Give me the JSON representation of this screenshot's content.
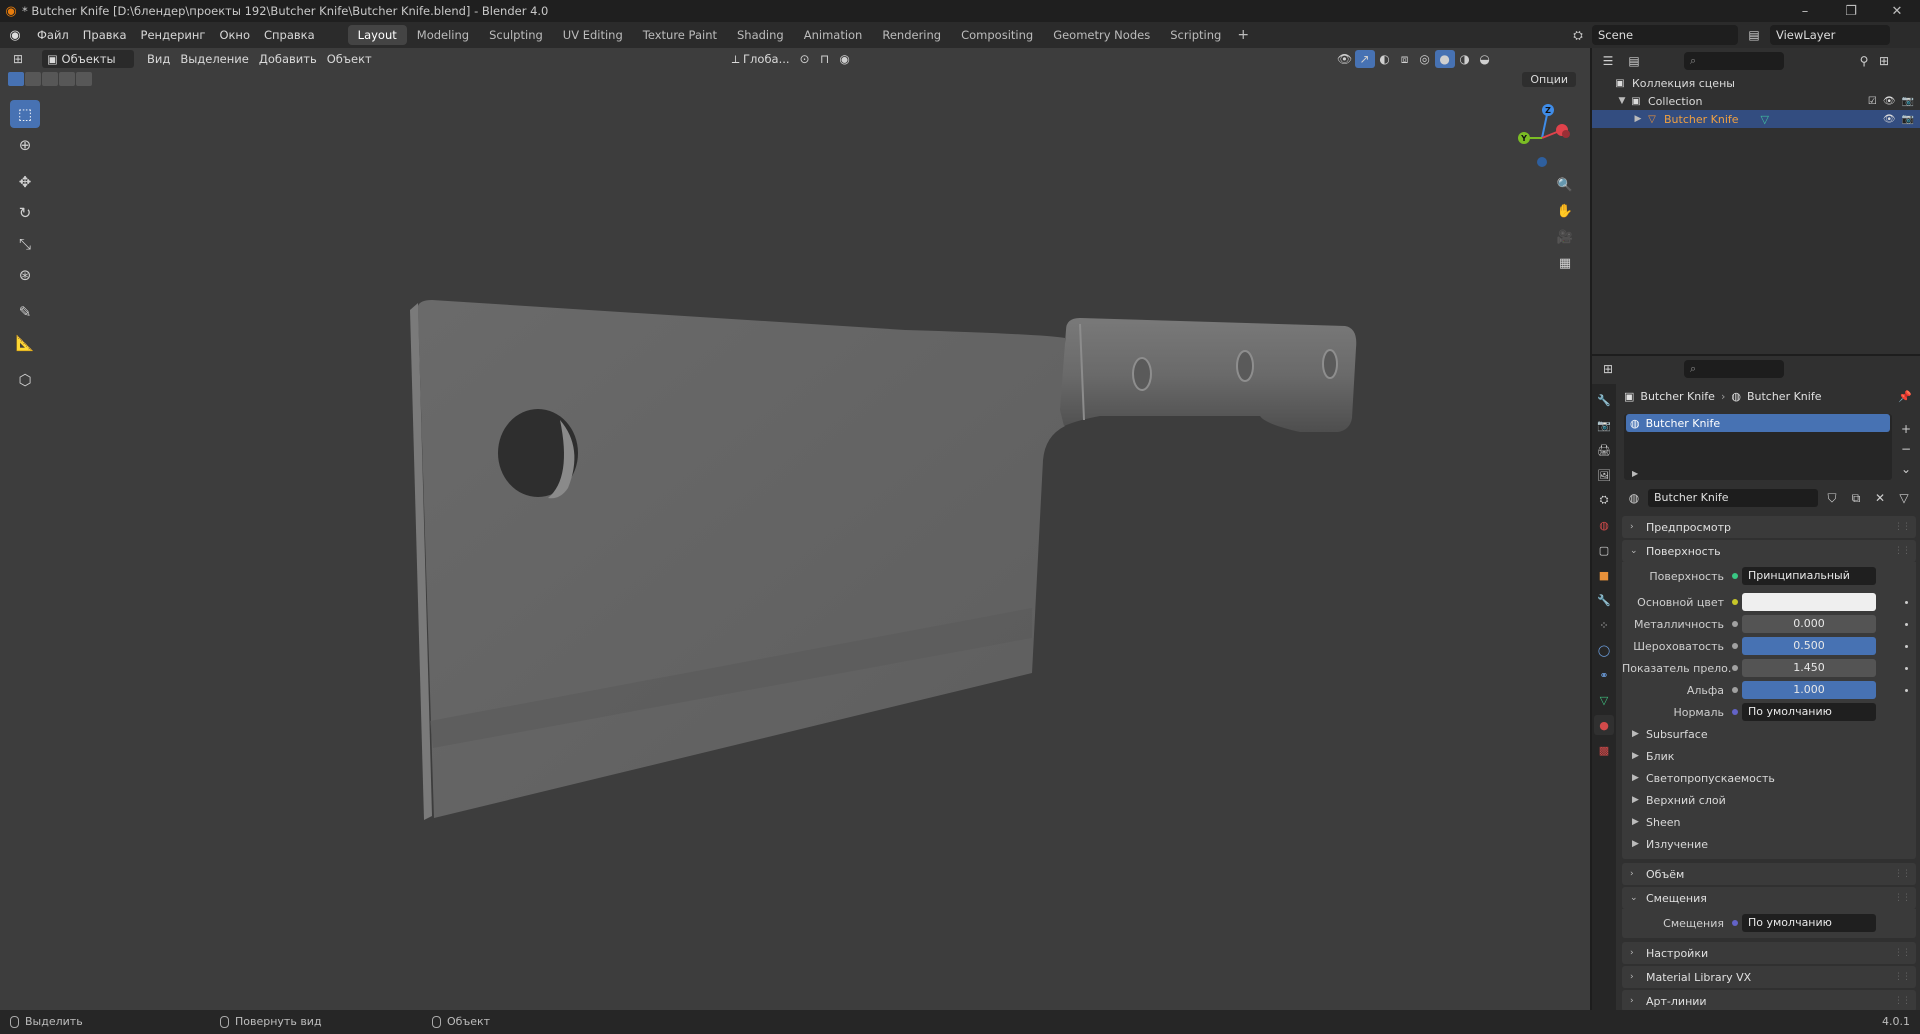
{
  "window": {
    "title": "* Butcher Knife [D:\\блендер\\проекты 192\\Butcher Knife\\Butcher Knife.blend] - Blender 4.0"
  },
  "menu": [
    "Файл",
    "Правка",
    "Рендеринг",
    "Окно",
    "Справка"
  ],
  "workspaces": [
    "Layout",
    "Modeling",
    "Sculpting",
    "UV Editing",
    "Texture Paint",
    "Shading",
    "Animation",
    "Rendering",
    "Compositing",
    "Geometry Nodes",
    "Scripting"
  ],
  "active_workspace": "Layout",
  "scene": {
    "name": "Scene",
    "view_layer": "ViewLayer"
  },
  "viewport": {
    "mode": "Объекты",
    "menus": [
      "Вид",
      "Выделение",
      "Добавить",
      "Объект"
    ],
    "orientation": "Глоба...",
    "options": "Опции"
  },
  "outliner": {
    "root": "Коллекция сцены",
    "collection": "Collection",
    "object": "Butcher Knife"
  },
  "properties": {
    "breadcrumb_object": "Butcher Knife",
    "breadcrumb_material": "Butcher Knife",
    "slot_name": "Butcher Knife",
    "material_name": "Butcher Knife",
    "sections": {
      "preview": "Предпросмотр",
      "surface": "Поверхность",
      "volume": "Объём",
      "displacement": "Смещения",
      "settings": "Настройки",
      "library": "Material Library VX",
      "lineart": "Арт-линии"
    },
    "surface": {
      "surface_label": "Поверхность",
      "surface_value": "Принципиальный BSDF",
      "base_color_label": "Основной цвет",
      "base_color": "#efefef",
      "metallic_label": "Металличность",
      "metallic_value": "0.000",
      "roughness_label": "Шероховатость",
      "roughness_value": "0.500",
      "roughness_fraction": 0.5,
      "ior_label": "Показатель прело...",
      "ior_value": "1.450",
      "alpha_label": "Альфа",
      "alpha_value": "1.000",
      "alpha_fraction": 1.0,
      "normal_label": "Нормаль",
      "normal_value": "По умолчанию"
    },
    "subpanels": [
      "Subsurface",
      "Блик",
      "Светопропускаемость",
      "Верхний слой",
      "Sheen",
      "Излучение"
    ],
    "displacement": {
      "label": "Смещения",
      "value": "По умолчанию"
    }
  },
  "statusbar": {
    "select": "Выделить",
    "rotate": "Повернуть вид",
    "object": "Объект",
    "version": "4.0.1"
  },
  "colors": {
    "accent": "#4772b3",
    "selected_row": "#334d80",
    "object_orange": "#e8913a",
    "axis_x": "#e0424b",
    "axis_y": "#7bbd24",
    "axis_z": "#3f8ce8"
  }
}
